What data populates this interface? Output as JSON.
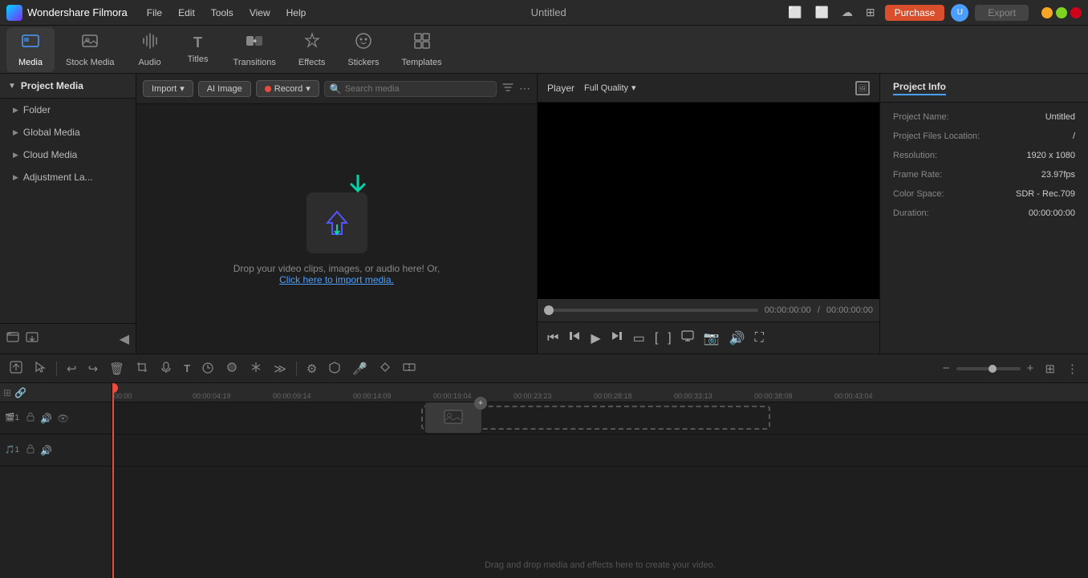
{
  "app": {
    "brand": "Wondershare Filmora",
    "title": "Untitled"
  },
  "titlebar": {
    "menu": [
      "File",
      "Edit",
      "Tools",
      "View",
      "Help"
    ],
    "purchase_label": "Purchase",
    "export_label": "Export"
  },
  "toolbar": {
    "items": [
      {
        "id": "media",
        "label": "Media",
        "icon": "🎬"
      },
      {
        "id": "stock-media",
        "label": "Stock Media",
        "icon": "📷"
      },
      {
        "id": "audio",
        "label": "Audio",
        "icon": "🎵"
      },
      {
        "id": "titles",
        "label": "Titles",
        "icon": "T"
      },
      {
        "id": "transitions",
        "label": "Transitions",
        "icon": "⬛"
      },
      {
        "id": "effects",
        "label": "Effects",
        "icon": "✨"
      },
      {
        "id": "stickers",
        "label": "Stickers",
        "icon": "🌟"
      },
      {
        "id": "templates",
        "label": "Templates",
        "icon": "⬜"
      }
    ]
  },
  "left_panel": {
    "title": "Project Media",
    "items": [
      {
        "label": "Folder"
      },
      {
        "label": "Global Media"
      },
      {
        "label": "Cloud Media"
      },
      {
        "label": "Adjustment La..."
      }
    ]
  },
  "media_toolbar": {
    "import_label": "Import",
    "ai_image_label": "AI Image",
    "record_label": "Record",
    "search_placeholder": "Search media"
  },
  "drop_zone": {
    "text": "Drop your video clips, images, or audio here! Or,",
    "link_text": "Click here to import media."
  },
  "player": {
    "tab_label": "Player",
    "quality_label": "Full Quality",
    "time_current": "00:00:00:00",
    "time_total": "00:00:00:00"
  },
  "project_info": {
    "tab_label": "Project Info",
    "fields": [
      {
        "label": "Project Name:",
        "value": "Untitled"
      },
      {
        "label": "Project Files Location:",
        "value": "/"
      },
      {
        "label": "Resolution:",
        "value": "1920 x 1080"
      },
      {
        "label": "Frame Rate:",
        "value": "23.97fps"
      },
      {
        "label": "Color Space:",
        "value": "SDR - Rec.709"
      },
      {
        "label": "Duration:",
        "value": "00:00:00:00"
      }
    ]
  },
  "timeline": {
    "ruler_marks": [
      "00:00",
      "00:00:04:19",
      "00:00:09:14",
      "00:00:14:09",
      "00:00:19:04",
      "00:00:23:23",
      "00:00:28:18",
      "00:00:33:13",
      "00:00:38:08",
      "00:00:43:04"
    ],
    "drop_text": "Drag and drop media and effects here to create your video."
  }
}
